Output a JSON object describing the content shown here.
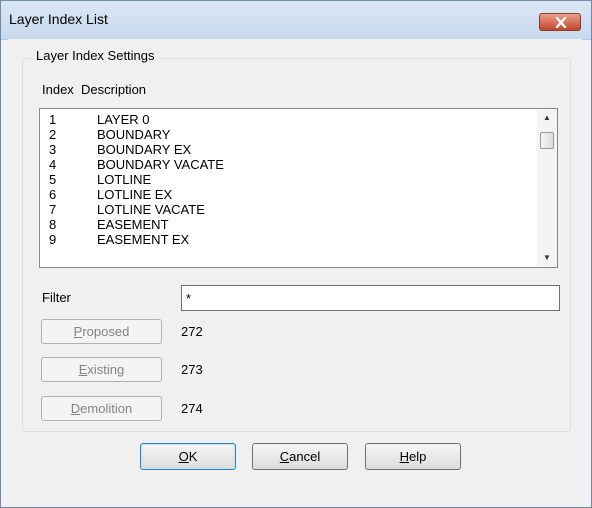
{
  "window": {
    "title": "Layer Index List"
  },
  "group": {
    "legend": "Layer Index Settings"
  },
  "list": {
    "headers": {
      "index": "Index",
      "description": "Description"
    },
    "rows": [
      {
        "index": "1",
        "description": "LAYER 0"
      },
      {
        "index": "2",
        "description": "BOUNDARY"
      },
      {
        "index": "3",
        "description": "BOUNDARY EX"
      },
      {
        "index": "4",
        "description": "BOUNDARY VACATE"
      },
      {
        "index": "5",
        "description": "LOTLINE"
      },
      {
        "index": "6",
        "description": "LOTLINE EX"
      },
      {
        "index": "7",
        "description": "LOTLINE VACATE"
      },
      {
        "index": "8",
        "description": "EASEMENT"
      },
      {
        "index": "9",
        "description": "EASEMENT EX"
      }
    ]
  },
  "filter": {
    "label": "Filter",
    "value": "*"
  },
  "settings": {
    "proposed": {
      "accel": "P",
      "rest": "roposed",
      "value": "272"
    },
    "existing": {
      "accel": "E",
      "rest": "xisting",
      "value": "273"
    },
    "demolition": {
      "accel": "D",
      "rest": "emolition",
      "value": "274"
    }
  },
  "buttons": {
    "ok": {
      "accel": "O",
      "rest": "K"
    },
    "cancel": {
      "accel": "C",
      "rest": "ancel"
    },
    "help": {
      "accel": "H",
      "rest": "elp"
    }
  },
  "icons": {
    "close": "close-icon",
    "scroll_up": "arrow-up-icon",
    "scroll_down": "arrow-down-icon"
  }
}
